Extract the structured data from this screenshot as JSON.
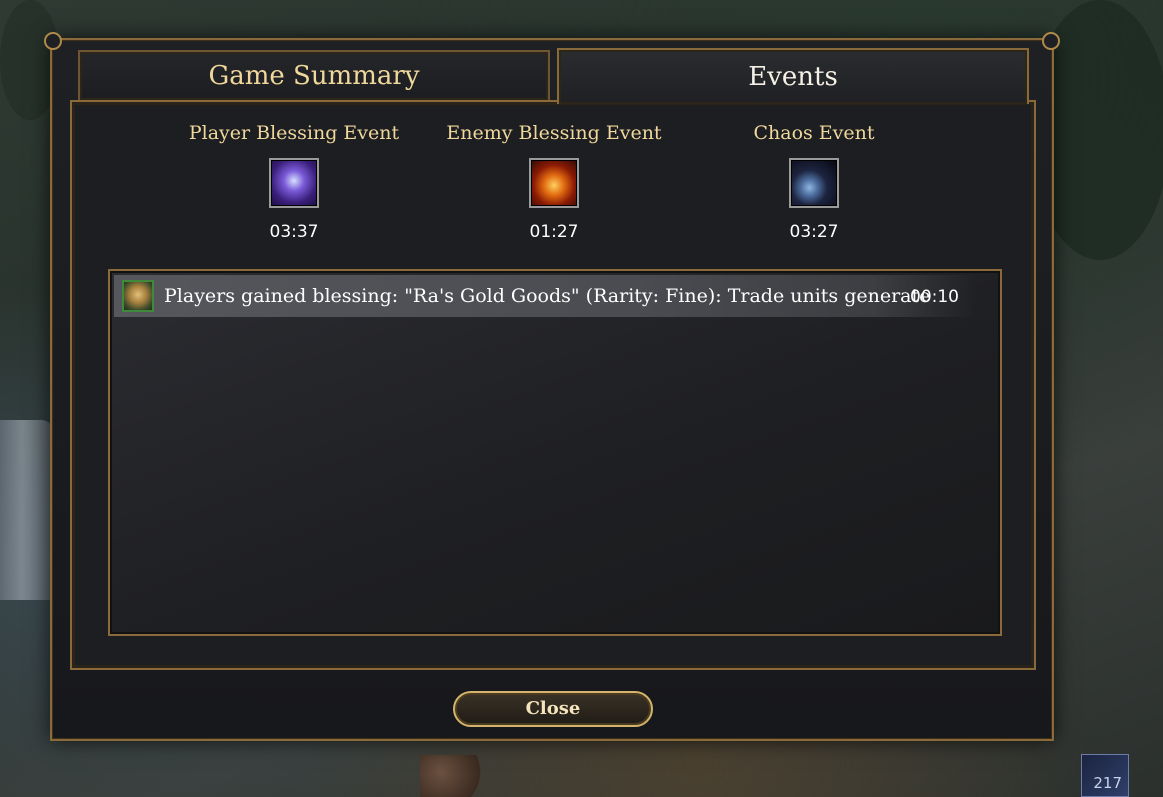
{
  "tabs": {
    "game_summary": "Game Summary",
    "events": "Events"
  },
  "events": [
    {
      "title": "Player Blessing Event",
      "icon": "lightning-staff-icon",
      "time": "03:37"
    },
    {
      "title": "Enemy Blessing Event",
      "icon": "fire-demon-icon",
      "time": "01:27"
    },
    {
      "title": "Chaos Event",
      "icon": "planet-meteor-icon",
      "time": "03:27"
    }
  ],
  "log": [
    {
      "icon": "camel-trader-icon",
      "text": "Players gained blessing: \"Ra's Gold Goods\" (Rarity: Fine): Trade units generate",
      "time": "00:10"
    }
  ],
  "close_label": "Close",
  "hud": {
    "corner_value": "217"
  },
  "colors": {
    "accent_gold": "#8a6a3a",
    "title_text": "#f0d79b"
  }
}
